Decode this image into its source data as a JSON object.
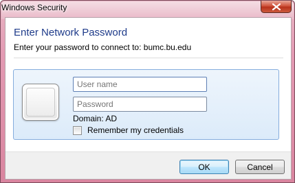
{
  "window": {
    "title": "Windows Security"
  },
  "dialog": {
    "title": "Enter Network Password",
    "subtitle": "Enter your password to connect to: bumc.bu.edu"
  },
  "credentials": {
    "username_placeholder": "User name",
    "password_placeholder": "Password",
    "domain_label": "Domain: AD",
    "remember_label": "Remember my credentials",
    "remember_checked": false
  },
  "buttons": {
    "ok_label": "OK",
    "cancel_label": "Cancel"
  },
  "icons": {
    "close": "close-icon",
    "user_tile": "user-tile-icon",
    "checkbox": "checkbox-icon"
  },
  "colors": {
    "title_blue": "#1e3b8a",
    "frame_pink": "#e39ab3",
    "close_red": "#c7432a",
    "tile_border": "#84acdd",
    "ok_border": "#3c7fb1"
  }
}
